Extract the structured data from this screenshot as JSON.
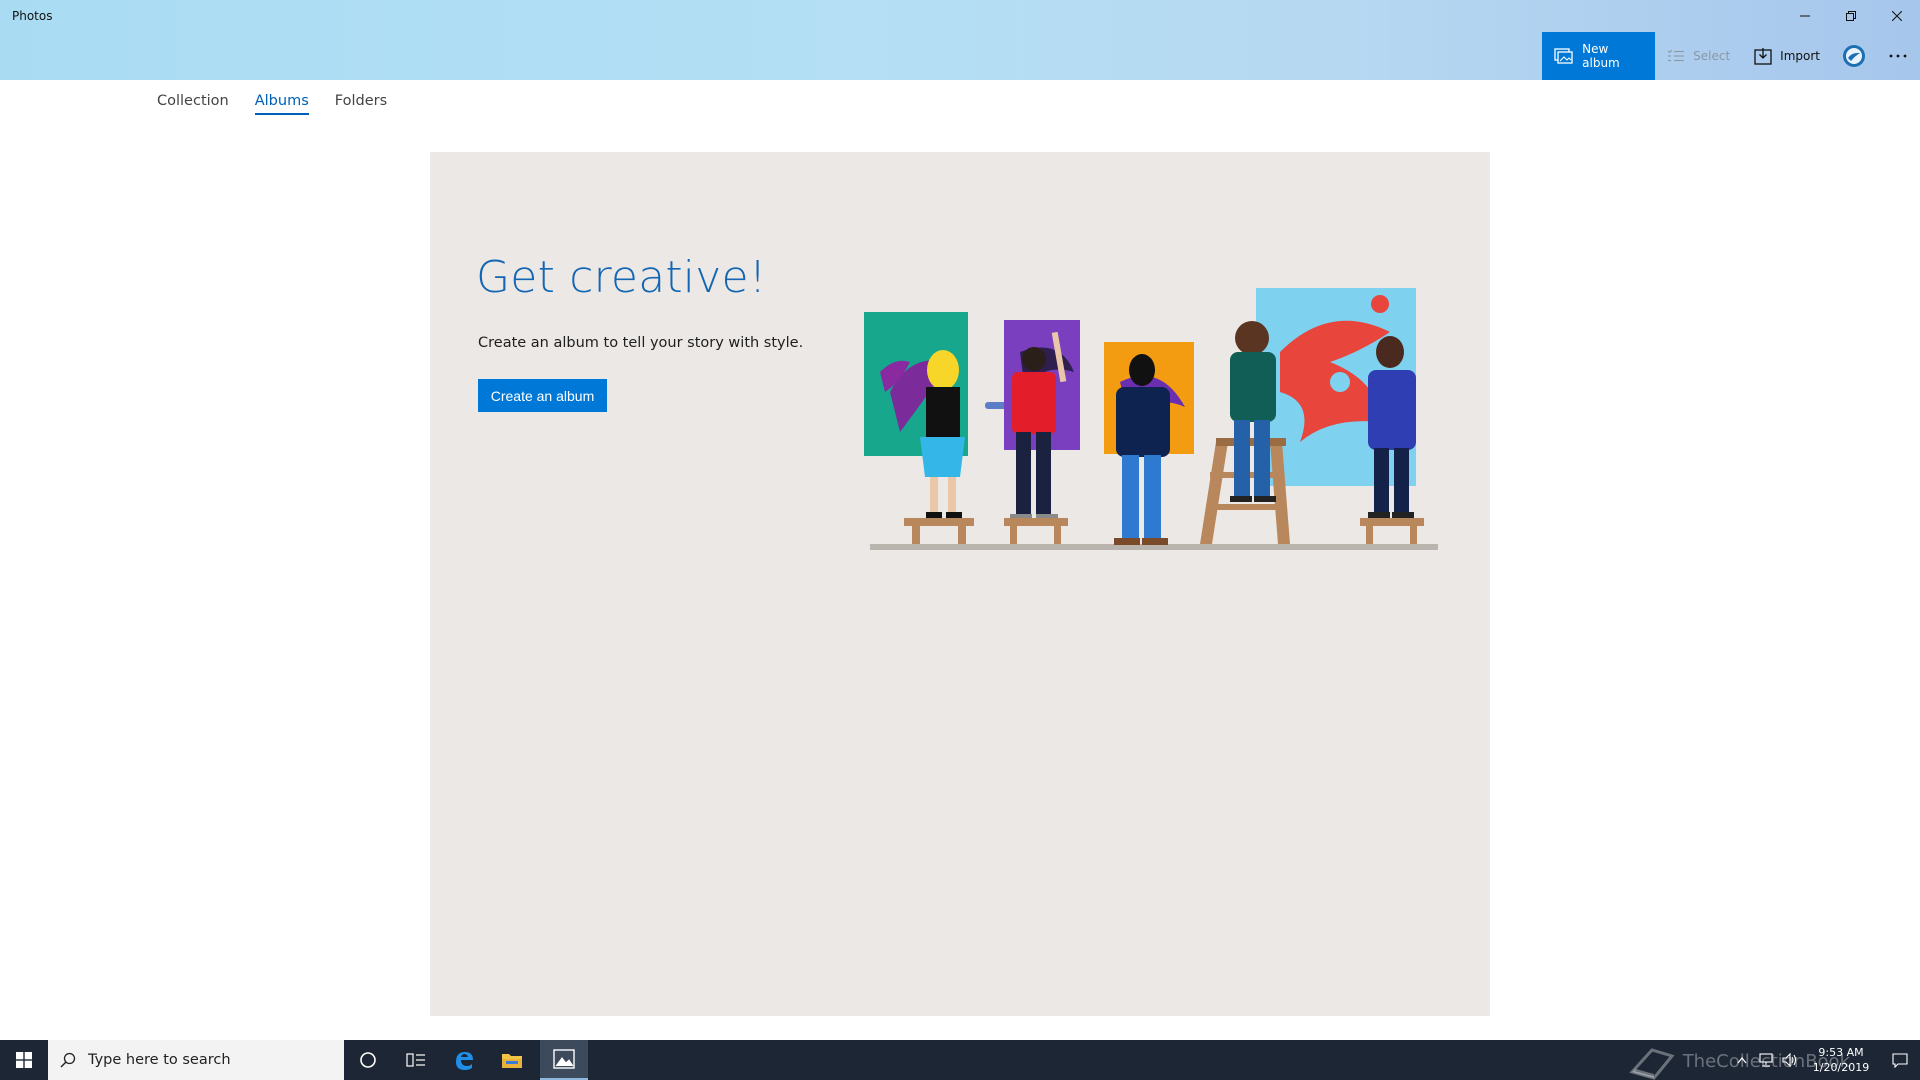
{
  "window": {
    "title": "Photos"
  },
  "toolbar": {
    "new_album": "New album",
    "select": "Select",
    "import": "Import"
  },
  "tabs": [
    {
      "label": "Collection",
      "active": false
    },
    {
      "label": "Albums",
      "active": true
    },
    {
      "label": "Folders",
      "active": false
    }
  ],
  "hero": {
    "title": "Get creative!",
    "subtitle": "Create an album to tell your story with style.",
    "button": "Create an album"
  },
  "taskbar": {
    "search_placeholder": "Type here to search",
    "clock_time": "9:53 AM",
    "clock_date": "1/20/2019",
    "watermark": "TheCollectionBook"
  },
  "colors": {
    "accent": "#0078d7",
    "title_blue": "#1366b3",
    "card_bg": "#ece8e5",
    "taskbar_bg": "#1c2634"
  }
}
